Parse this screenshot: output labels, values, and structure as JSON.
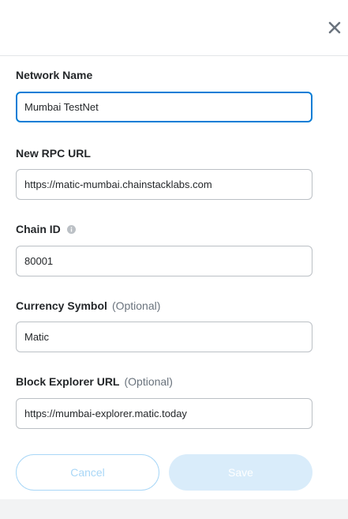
{
  "form": {
    "network_name": {
      "label": "Network Name",
      "value": "Mumbai TestNet"
    },
    "rpc_url": {
      "label": "New RPC URL",
      "value": "https://matic-mumbai.chainstacklabs.com"
    },
    "chain_id": {
      "label": "Chain ID",
      "value": "80001"
    },
    "currency_symbol": {
      "label": "Currency Symbol",
      "optional": "(Optional)",
      "value": "Matic"
    },
    "block_explorer": {
      "label": "Block Explorer URL",
      "optional": "(Optional)",
      "value": "https://mumbai-explorer.matic.today"
    }
  },
  "actions": {
    "cancel_label": "Cancel",
    "save_label": "Save"
  },
  "icons": {
    "close": "close-icon",
    "info": "info-icon"
  },
  "colors": {
    "focus_border": "#037dd6",
    "primary_disabled": "#d9ecfa",
    "secondary_disabled": "#a9d7f7"
  }
}
